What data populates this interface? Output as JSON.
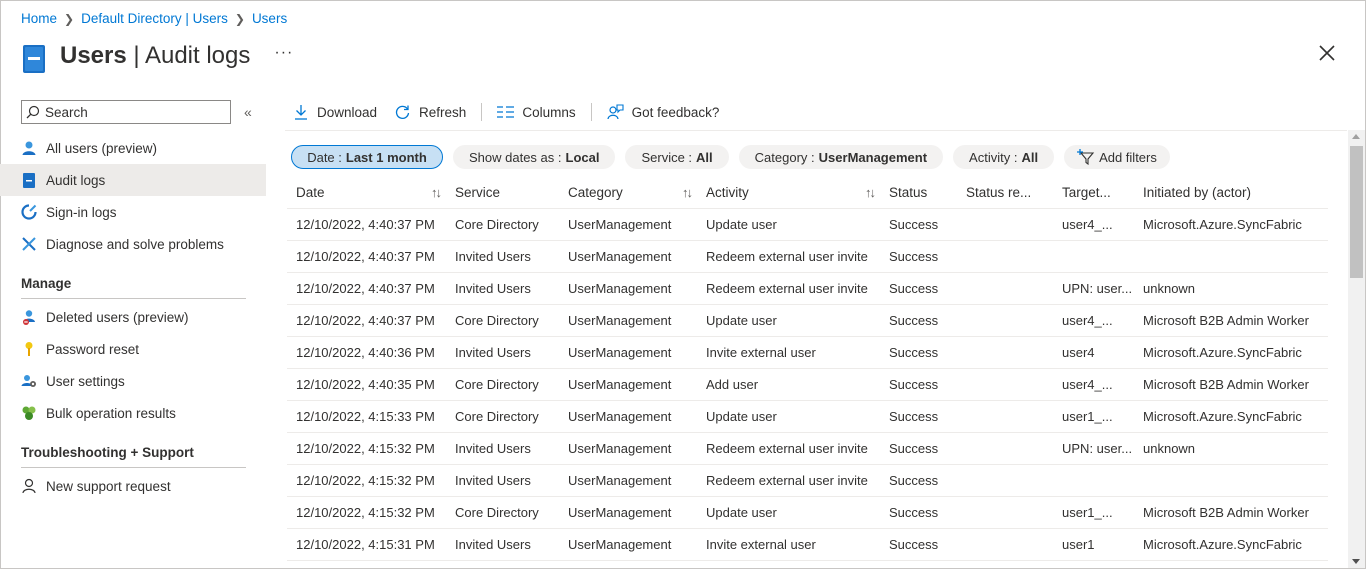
{
  "breadcrumb": [
    "Home",
    "Default Directory | Users",
    "Users"
  ],
  "header": {
    "title_bold": "Users",
    "title_rest": " | Audit logs",
    "more": "···"
  },
  "sidebar": {
    "search_placeholder": "Search",
    "collapse": "«",
    "items": [
      {
        "label": "All users (preview)",
        "icon": "user-icon"
      },
      {
        "label": "Audit logs",
        "icon": "audit-log-icon",
        "active": true
      },
      {
        "label": "Sign-in logs",
        "icon": "sign-in-icon"
      },
      {
        "label": "Diagnose and solve problems",
        "icon": "wrench-icon"
      }
    ],
    "manage_title": "Manage",
    "manage_items": [
      {
        "label": "Deleted users (preview)",
        "icon": "deleted-user-icon"
      },
      {
        "label": "Password reset",
        "icon": "key-icon"
      },
      {
        "label": "User settings",
        "icon": "user-settings-icon"
      },
      {
        "label": "Bulk operation results",
        "icon": "bulk-operation-icon"
      }
    ],
    "support_title": "Troubleshooting + Support",
    "support_items": [
      {
        "label": "New support request",
        "icon": "support-icon"
      }
    ]
  },
  "toolbar": {
    "download": "Download",
    "refresh": "Refresh",
    "columns": "Columns",
    "feedback": "Got feedback?"
  },
  "filters": [
    {
      "label": "Date :",
      "value": "Last 1 month",
      "active": true
    },
    {
      "label": "Show dates as :",
      "value": "Local"
    },
    {
      "label": "Service :",
      "value": "All"
    },
    {
      "label": "Category :",
      "value": "UserManagement"
    },
    {
      "label": "Activity :",
      "value": "All"
    }
  ],
  "add_filters": "Add filters",
  "table": {
    "columns": [
      "Date",
      "Service",
      "Category",
      "Activity",
      "Status",
      "Status re...",
      "Target...",
      "Initiated by (actor)"
    ],
    "rows": [
      [
        "12/10/2022, 4:40:37 PM",
        "Core Directory",
        "UserManagement",
        "Update user",
        "Success",
        "",
        "user4_...",
        "Microsoft.Azure.SyncFabric"
      ],
      [
        "12/10/2022, 4:40:37 PM",
        "Invited Users",
        "UserManagement",
        "Redeem external user invite",
        "Success",
        "",
        "",
        ""
      ],
      [
        "12/10/2022, 4:40:37 PM",
        "Invited Users",
        "UserManagement",
        "Redeem external user invite",
        "Success",
        "",
        "UPN: user...",
        "unknown"
      ],
      [
        "12/10/2022, 4:40:37 PM",
        "Core Directory",
        "UserManagement",
        "Update user",
        "Success",
        "",
        "user4_...",
        "Microsoft B2B Admin Worker"
      ],
      [
        "12/10/2022, 4:40:36 PM",
        "Invited Users",
        "UserManagement",
        "Invite external user",
        "Success",
        "",
        "user4",
        "Microsoft.Azure.SyncFabric"
      ],
      [
        "12/10/2022, 4:40:35 PM",
        "Core Directory",
        "UserManagement",
        "Add user",
        "Success",
        "",
        "user4_...",
        "Microsoft B2B Admin Worker"
      ],
      [
        "12/10/2022, 4:15:33 PM",
        "Core Directory",
        "UserManagement",
        "Update user",
        "Success",
        "",
        "user1_...",
        "Microsoft.Azure.SyncFabric"
      ],
      [
        "12/10/2022, 4:15:32 PM",
        "Invited Users",
        "UserManagement",
        "Redeem external user invite",
        "Success",
        "",
        "UPN: user...",
        "unknown"
      ],
      [
        "12/10/2022, 4:15:32 PM",
        "Invited Users",
        "UserManagement",
        "Redeem external user invite",
        "Success",
        "",
        "",
        ""
      ],
      [
        "12/10/2022, 4:15:32 PM",
        "Core Directory",
        "UserManagement",
        "Update user",
        "Success",
        "",
        "user1_...",
        "Microsoft B2B Admin Worker"
      ],
      [
        "12/10/2022, 4:15:31 PM",
        "Invited Users",
        "UserManagement",
        "Invite external user",
        "Success",
        "",
        "user1",
        "Microsoft.Azure.SyncFabric"
      ]
    ]
  },
  "colors": {
    "accent": "#0078d4",
    "active_pill_bg": "#c7e0f4",
    "nav_active_bg": "#edebe9"
  }
}
